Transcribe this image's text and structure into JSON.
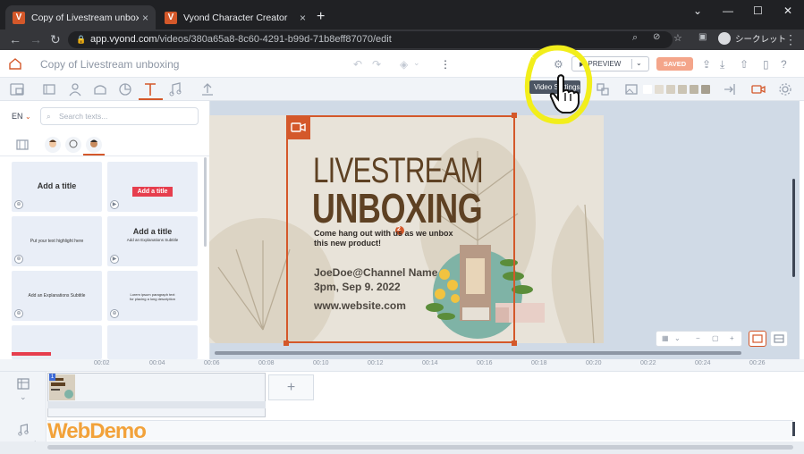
{
  "browser": {
    "tabs": [
      {
        "title": "Copy of Livestream unboxing - V",
        "favicon": "V"
      },
      {
        "title": "Vyond Character Creator",
        "favicon": "V"
      }
    ],
    "url_domain": "app.vyond.com",
    "url_path": "/videos/380a65a8-8c60-4291-b99d-71b8eff87070/edit",
    "profile_label": "シークレット",
    "new_tab": "+",
    "close_tab": "×"
  },
  "header": {
    "video_title": "Copy of Livestream unboxing",
    "preview_label": "PREVIEW",
    "saved_label": "SAVED"
  },
  "toolbar": {
    "tooltip": "Video Settings",
    "swatches": [
      "#ffffff",
      "#e3ddd2",
      "#d6cfc1",
      "#cbc4b4",
      "#bdb6a5",
      "#a69f8f"
    ]
  },
  "leftpanel": {
    "language": "EN",
    "search_placeholder": "Search texts...",
    "cards": [
      {
        "label": "Add a title",
        "style": "plain"
      },
      {
        "label": "Add a title",
        "style": "ribbon"
      },
      {
        "label": "Put your text highlight here",
        "style": "small"
      },
      {
        "label": "Add a title",
        "sub": "Add an Explanations Subtitle",
        "style": "title-sub"
      },
      {
        "label": "Add an Explanations Subtitle",
        "style": "small"
      },
      {
        "label": "Lorem ipsum paragraph text for placing a long description",
        "style": "tiny"
      }
    ]
  },
  "canvas": {
    "line1": "LIVESTREAM",
    "line2": "UNBOXING",
    "subtitle": "Come hang out with us as we unbox this new product!",
    "channel": "JoeDoe@Channel Name",
    "date": "3pm, Sep 9. 2022",
    "website": "www.website.com",
    "number_badge": "2"
  },
  "timeline": {
    "ticks": [
      "00:02",
      "00:04",
      "00:06",
      "00:08",
      "00:10",
      "00:12",
      "00:14",
      "00:16",
      "00:18",
      "00:20",
      "00:22",
      "00:24",
      "00:26"
    ],
    "scene_number": "1",
    "add_scene": "+"
  },
  "watermark": "WebDemo"
}
